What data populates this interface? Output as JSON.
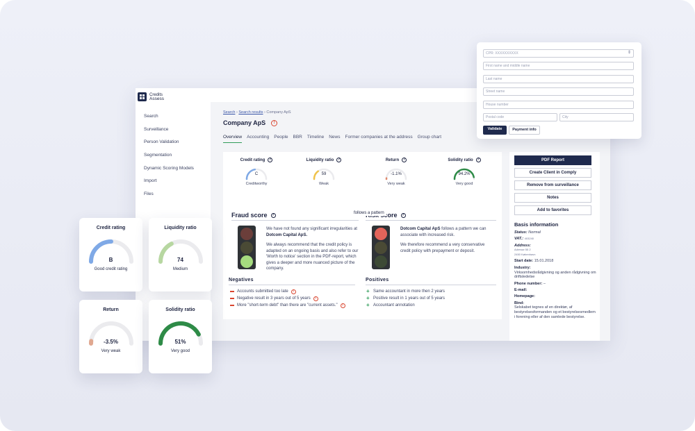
{
  "app": {
    "logo": {
      "line1": "Credits",
      "line2": "Assess"
    },
    "sidebar": {
      "items": [
        {
          "label": "Search"
        },
        {
          "label": "Surveillance"
        },
        {
          "label": "Person Validation"
        },
        {
          "label": "Segmentation"
        },
        {
          "label": "Dynamic Scoring Models"
        },
        {
          "label": "Import"
        },
        {
          "label": "Files"
        }
      ]
    },
    "breadcrumb": {
      "search": "Search",
      "results": "Search results",
      "current": "Company ApS",
      "sep": "›"
    },
    "company_name": "Company ApS",
    "tabs": [
      {
        "label": "Overview"
      },
      {
        "label": "Accounting"
      },
      {
        "label": "People"
      },
      {
        "label": "BBR"
      },
      {
        "label": "Timeline"
      },
      {
        "label": "News"
      },
      {
        "label": "Former companies at the address"
      },
      {
        "label": "Group chart"
      }
    ],
    "ratios": [
      {
        "label": "Credit rating",
        "value": "C",
        "desc": "Creditworthy",
        "level": 0.45,
        "color": "#7fa9e6"
      },
      {
        "label": "Liquidity ratio",
        "value": "59",
        "desc": "Weak",
        "level": 0.3,
        "color": "#f0c34a"
      },
      {
        "label": "Return",
        "value": "-1.1%",
        "desc": "Very weak",
        "level": 0.03,
        "color": "#e08a6e"
      },
      {
        "label": "Solidity ratio",
        "value": "94.2%",
        "desc": "Very good",
        "level": 0.94,
        "color": "#2e8b47"
      }
    ],
    "fraud": {
      "title": "Fraud score",
      "p1_a": "We have not found any significant irregularities at ",
      "p1_b": "Dotcom Capital ApS.",
      "p2": "We always recommend that the credit policy is adapted on an ongoing basis and also refer to our 'Worth to notice' section in the PDF-report, which gives a deeper and more nuanced picture of the company."
    },
    "risk": {
      "title": "Risk score",
      "tooltip": "follows a pattern",
      "p1_a": "Dotcom Capital ApS",
      "p1_b": " follows a pattern we can associate with increased risk.",
      "p2": "We therefore recommend a very conservative credit policy with prepayment or deposit."
    },
    "negatives": {
      "title": "Negatives",
      "items": [
        {
          "label": "Accounts submitted too late"
        },
        {
          "label": "Negative result in 3 years out of 5 years"
        },
        {
          "label": "More \"short-term debt\" than there are \"current assets.\""
        }
      ]
    },
    "positives": {
      "title": "Positives",
      "items": [
        {
          "label": "Same accountant in more then 2 years"
        },
        {
          "label": "Positive result in 1 years out of 5 years"
        },
        {
          "label": "Accountant annotation"
        }
      ]
    },
    "actions": {
      "pdf": "PDF Report",
      "comply": "Create Client in Comply",
      "remove": "Remove from surveillance",
      "notes": "Notes",
      "favorites": "Add to favorites"
    },
    "basis": {
      "title": "Basis information",
      "status_label": "Status:",
      "status_value": "Normal",
      "vat_label": "VAT.:",
      "vat_value": "403240",
      "address_label": "Address:",
      "address_line1": "Adresse 55 2",
      "address_line2": "2450 København",
      "start_label": "Start date:",
      "start_value": "15.01.2018",
      "industry_label": "Industry:",
      "industry_value": "Virksomhedsrådgivning og anden rådgivning om driftsledelse",
      "phone_label": "Phone number:",
      "phone_value": "–",
      "email_label": "E-mail:",
      "homepage_label": "Homepage:",
      "bind_label": "Bind:",
      "bind_value": "Selskabet tegnes af en direktør, af bestyrelsesformanden og et bestyrelsesmedlem i forening eller af den samlede bestyrelse."
    }
  },
  "form": {
    "cpr_placeholder": "CPR: XXXXXXXXXX",
    "first_placeholder": "First name and middle name",
    "last_placeholder": "Last name",
    "street_placeholder": "Street name",
    "house_placeholder": "House number",
    "postal_placeholder": "Postal code",
    "city_placeholder": "City",
    "validate": "Validate",
    "payment": "Payment info"
  },
  "cards": [
    {
      "title": "Credit rating",
      "value": "B",
      "desc": "Good credit rating",
      "level": 0.5,
      "color": "#7fa9e6"
    },
    {
      "title": "Liquidity ratio",
      "value": "74",
      "desc": "Medium",
      "level": 0.35,
      "color": "#b7d7a1"
    },
    {
      "title": "Return",
      "value": "-3.5%",
      "desc": "Very weak",
      "level": 0.04,
      "color": "#e0a890"
    },
    {
      "title": "Solidity ratio",
      "value": "51%",
      "desc": "Very good",
      "level": 0.85,
      "color": "#2e8b47"
    }
  ],
  "colors": {
    "navy": "#1f2a4d",
    "green": "#2e9c58",
    "red": "#d9452f"
  }
}
